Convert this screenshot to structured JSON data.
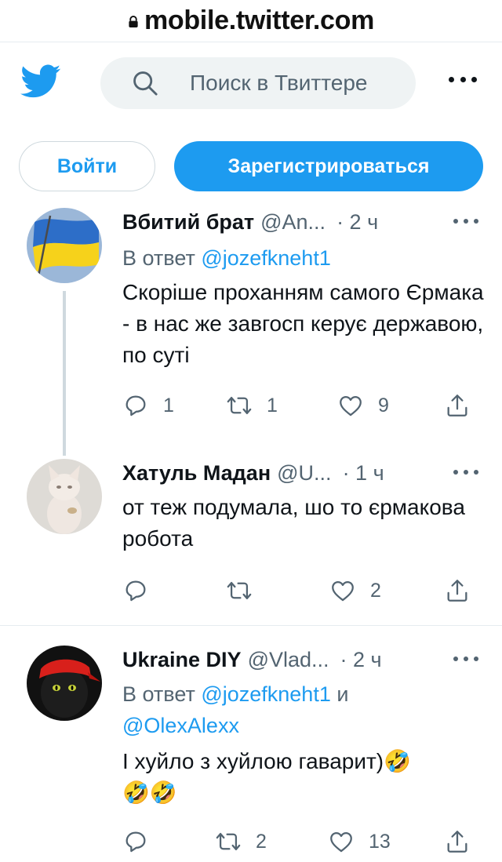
{
  "browser": {
    "url": "mobile.twitter.com"
  },
  "header": {
    "search_placeholder": "Поиск в Твиттере"
  },
  "auth": {
    "login_label": "Войти",
    "signup_label": "Зарегистрироваться"
  },
  "colors": {
    "accent": "#1d9bf0",
    "text": "#0f1419",
    "muted": "#536471"
  },
  "tweets": [
    {
      "name": "Вбитий брат",
      "handle": "@An...",
      "time": "· 2 ч",
      "reply_prefix": "В ответ ",
      "reply_mention_1": "@jozefkneht1",
      "text": "Скоріше проханням самого Єрмака - в нас же завгосп керує державою, по суті",
      "replies": "1",
      "retweets": "1",
      "likes": "9",
      "avatar_icon": "ukraine-flag-avatar"
    },
    {
      "name": "Хатуль Мадан",
      "handle": "@U...",
      "time": "· 1 ч",
      "text": "от теж подумала, шо то єрмакова робота",
      "replies": "",
      "retweets": "",
      "likes": "2",
      "avatar_icon": "cat-figurine-avatar"
    },
    {
      "name": "Ukraine DIY",
      "handle": "@Vlad...",
      "time": "· 2 ч",
      "reply_prefix": "В ответ ",
      "reply_mention_1": "@jozefkneht1",
      "reply_joiner": " и",
      "reply_mention_2": "@OlexAlexx",
      "text": "І хуйло з хуйлою гаварит)",
      "emoji": "🤣",
      "replies": "",
      "retweets": "2",
      "likes": "13",
      "avatar_icon": "black-cat-bandana-avatar"
    }
  ]
}
